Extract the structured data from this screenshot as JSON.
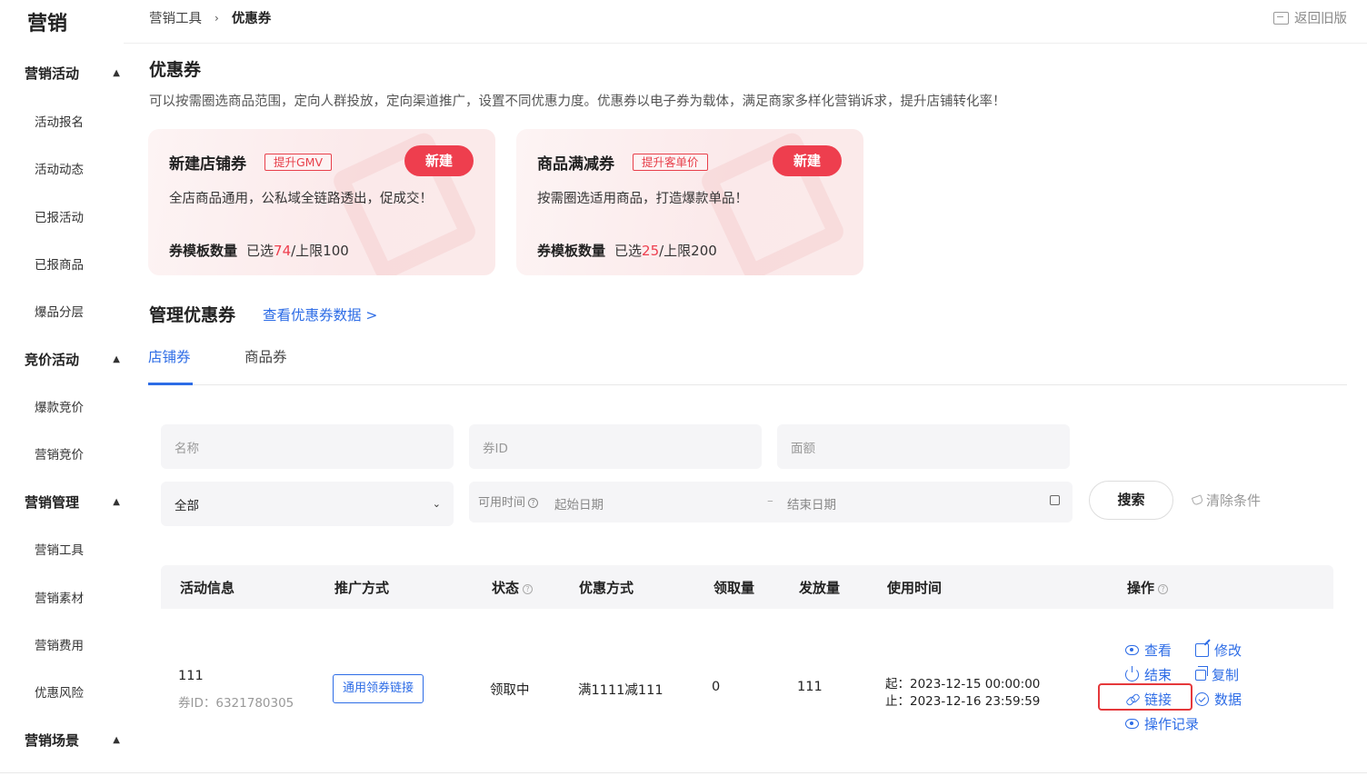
{
  "sidebar": {
    "title": "营销",
    "groups": [
      {
        "label": "营销活动",
        "items": [
          "活动报名",
          "活动动态",
          "已报活动",
          "已报商品",
          "爆品分层"
        ]
      },
      {
        "label": "竞价活动",
        "items": [
          "爆款竞价",
          "营销竞价"
        ]
      },
      {
        "label": "营销管理",
        "items": [
          "营销工具",
          "营销素材",
          "营销费用",
          "优惠风险"
        ]
      },
      {
        "label": "营销场景",
        "items": []
      }
    ]
  },
  "topbar": {
    "breadcrumb": [
      "营销工具",
      "优惠券"
    ],
    "breadcrumb_sep": "›",
    "back_old": "返回旧版"
  },
  "header": {
    "title": "优惠券",
    "description": "可以按需圈选商品范围，定向人群投放，定向渠道推广，设置不同优惠力度。优惠券以电子券为载体，满足商家多样化营销诉求，提升店铺转化率！"
  },
  "cards": [
    {
      "title": "新建店铺券",
      "tag": "提升GMV",
      "new_label": "新建",
      "desc": "全店商品通用，公私域全链路透出，促成交！",
      "quota_label": "券模板数量",
      "quota_prefix": "已选",
      "quota_used": "74",
      "quota_suffix": "/上限100"
    },
    {
      "title": "商品满减券",
      "tag": "提升客单价",
      "new_label": "新建",
      "desc": "按需圈选适用商品，打造爆款单品！",
      "quota_label": "券模板数量",
      "quota_prefix": "已选",
      "quota_used": "25",
      "quota_suffix": "/上限200"
    }
  ],
  "manage": {
    "title": "管理优惠券",
    "data_link": "查看优惠券数据 >",
    "tabs": [
      "店铺券",
      "商品券"
    ],
    "active_tab": "店铺券"
  },
  "filters": {
    "name_placeholder": "名称",
    "id_placeholder": "券ID",
    "amount_placeholder": "面额",
    "status_value": "全部",
    "date_label": "可用时间",
    "date_help": "?",
    "start_placeholder": "起始日期",
    "date_dash": "–",
    "end_placeholder": "结束日期",
    "search_label": "搜索",
    "clear_label": "清除条件"
  },
  "table": {
    "columns": [
      "活动信息",
      "推广方式",
      "状态",
      "优惠方式",
      "领取量",
      "发放量",
      "使用时间",
      "操作"
    ],
    "help_mark": "?",
    "rows": [
      {
        "name": "111",
        "coupon_id": "券ID：6321780305",
        "promo": "通用领券链接",
        "status": "领取中",
        "discount": "满1111减111",
        "claimed": "0",
        "issued": "111",
        "time_start": "起：2023-12-15 00:00:00",
        "time_end": "止：2023-12-16 23:59:59",
        "ops": {
          "view": "查看",
          "edit": "修改",
          "end": "结束",
          "copy": "复制",
          "link": "链接",
          "data": "数据",
          "log": "操作记录"
        }
      }
    ]
  },
  "colors": {
    "accent_blue": "#2d6ce6",
    "brand_red": "#ee3e4e",
    "highlight_red": "#e5383b"
  }
}
